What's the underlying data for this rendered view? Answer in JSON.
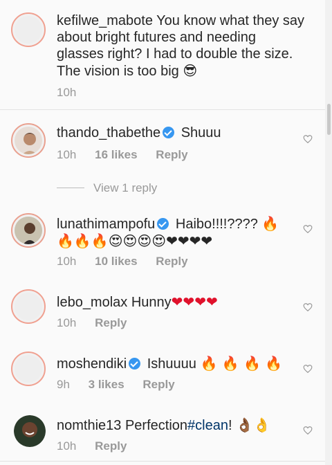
{
  "comments": [
    {
      "username": "kefilwe_mabote",
      "text": "You know what they say about bright futures and needing glasses right? I had to double the size. The vision is too big",
      "emoji": "😎",
      "time": "10h"
    },
    {
      "username": "thando_thabethe",
      "text": "Shuuu",
      "time": "10h",
      "likes": "16 likes",
      "reply": "Reply",
      "view_replies": "View 1 reply"
    },
    {
      "username": "lunathimampofu",
      "text": "Haibo!!!!????",
      "emoji": "🔥 🔥🔥🔥😍😍😍😍❤❤❤❤",
      "time": "10h",
      "likes": "10 likes",
      "reply": "Reply"
    },
    {
      "username": "lebo_molax",
      "text": "Hunny",
      "emoji": "❤❤❤❤",
      "time": "10h",
      "reply": "Reply"
    },
    {
      "username": "moshendiki",
      "text": "Ishuuuu",
      "emoji": "🔥 🔥 🔥 🔥",
      "time": "9h",
      "likes": "3 likes",
      "reply": "Reply"
    },
    {
      "username": "nomthie13",
      "text": "Perfection",
      "hashtag": "#clean",
      "after": "!",
      "emoji": "👌🏾👌",
      "time": "10h",
      "reply": "Reply"
    }
  ],
  "icons": {
    "like": "heart-outline-icon",
    "verified": "verified-badge-icon"
  },
  "colors": {
    "verified": "#3797f0",
    "hashtag": "#003569",
    "meta": "#999999",
    "story_ring": "#e9a08f"
  }
}
